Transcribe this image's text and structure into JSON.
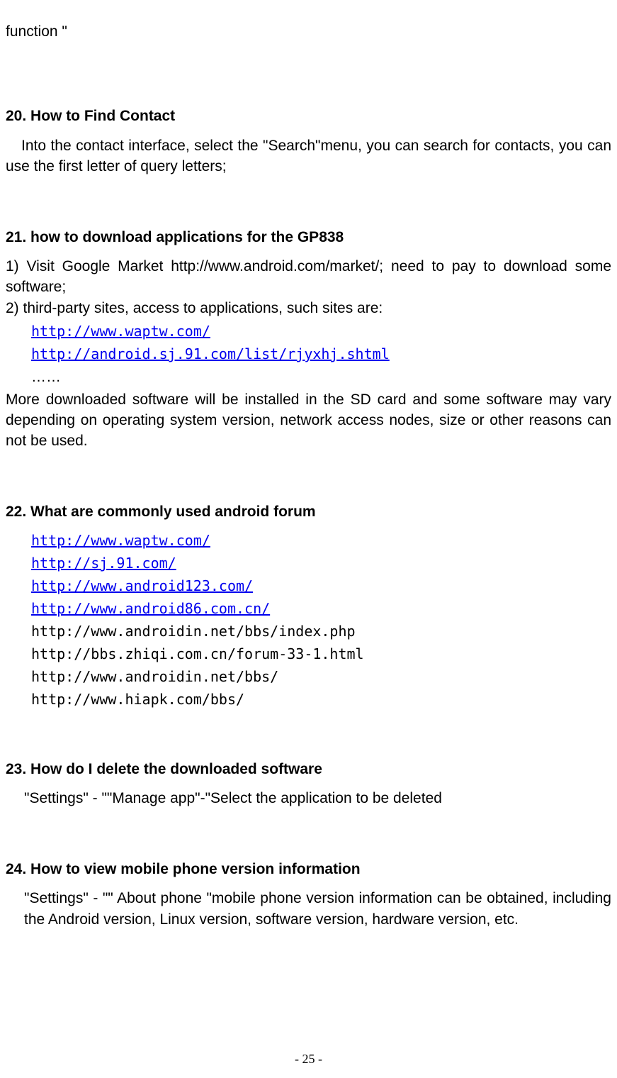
{
  "fragment": "function \"",
  "s20": {
    "heading": "20. How to Find Contact",
    "text": "Into the contact interface, select the \"Search\"menu, you can search for contacts, you can use the first letter of query letters;"
  },
  "s21": {
    "heading": "21. how to download applications for the GP838",
    "p1": "1) Visit Google Market http://www.android.com/market/; need to pay to download some software;",
    "p2": "2) third-party sites, access to applications, such sites are:",
    "link1": "http://www.waptw.com/",
    "link2": "http://android.sj.91.com/list/rjyxhj.shtml",
    "ellipsis": "……",
    "p3": "More downloaded software will be installed in the SD card and some software may vary depending on operating system version, network access nodes, size or other reasons can not be used."
  },
  "s22": {
    "heading": "22. What are commonly used android forum",
    "link1": "http://www.waptw.com/",
    "link2": "http://sj.91.com/",
    "link3": "http://www.android123.com/",
    "link4": "http://www.android86.com.cn/",
    "link5": "http://www.androidin.net/bbs/index.php",
    "link6": "http://bbs.zhiqi.com.cn/forum-33-1.html",
    "link7": "http://www.androidin.net/bbs/",
    "link8": "http://www.hiapk.com/bbs/"
  },
  "s23": {
    "heading": "23. How do I delete the downloaded software",
    "text": "\"Settings\" - \"\"Manage app\"-\"Select the application to be deleted"
  },
  "s24": {
    "heading": "24. How to view mobile phone version information",
    "text": "\"Settings\" - \"\" About phone \"mobile phone version information can be obtained, including the Android version, Linux version, software version, hardware version, etc."
  },
  "page_number": "- 25 -"
}
